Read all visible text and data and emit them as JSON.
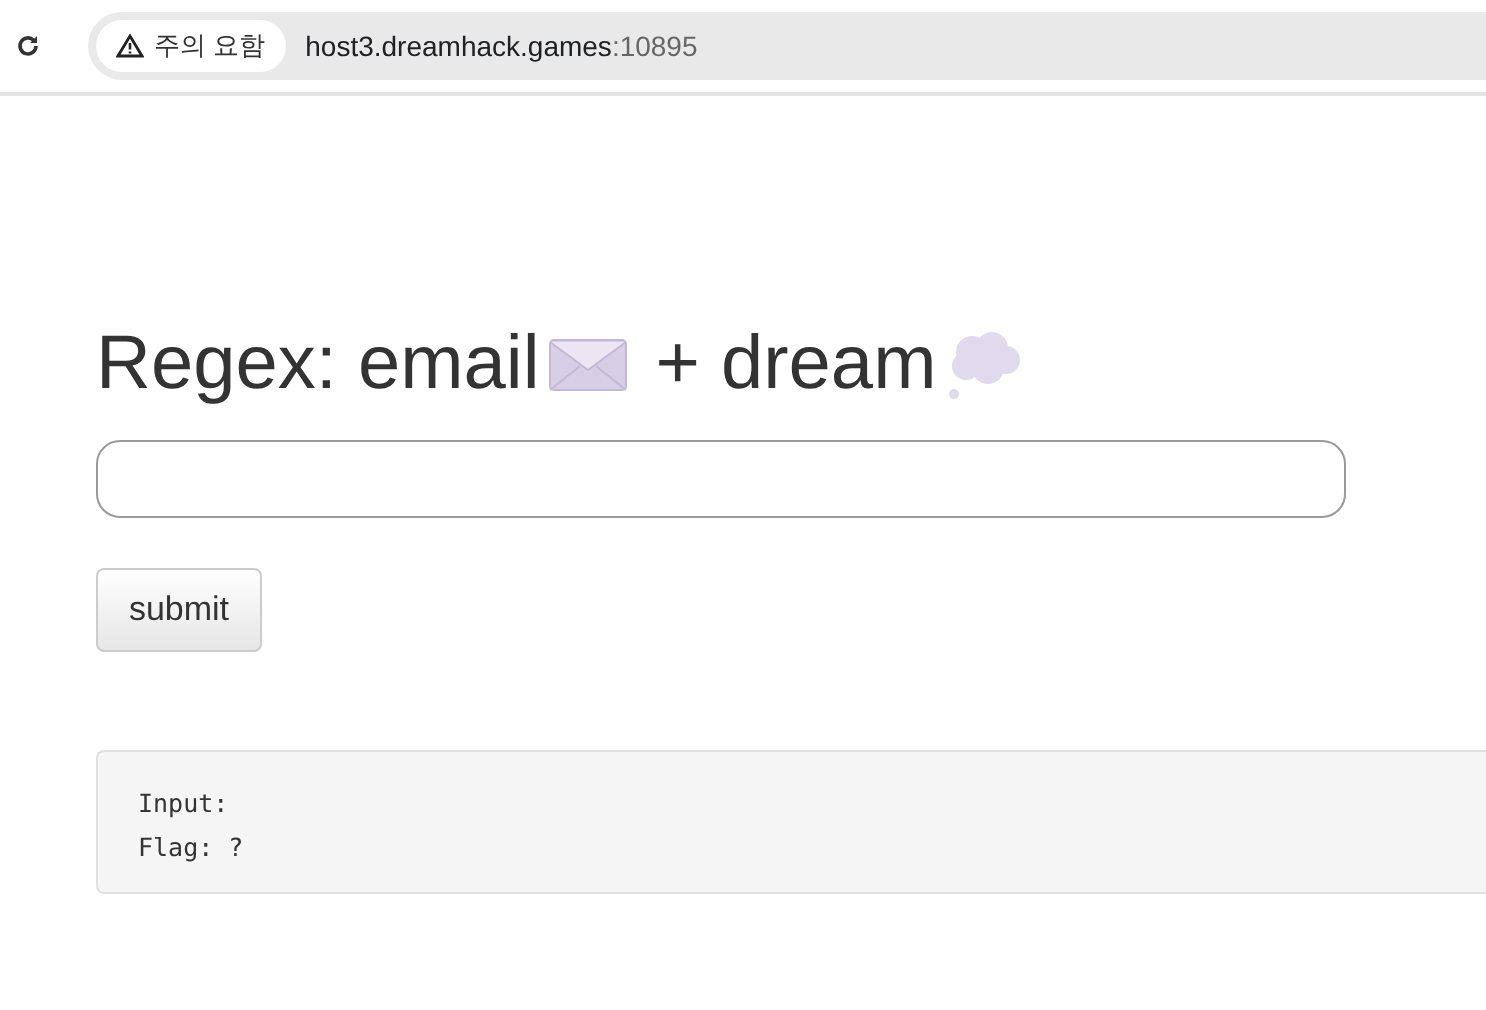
{
  "browser": {
    "warning": "주의 요함",
    "host": "host3.dreamhack.games",
    "port": ":10895"
  },
  "title": {
    "part_1": "Regex: email",
    "part_2": "+ dream"
  },
  "form": {
    "button": "submit"
  },
  "output": [
    "Input:",
    "Flag: ?"
  ]
}
